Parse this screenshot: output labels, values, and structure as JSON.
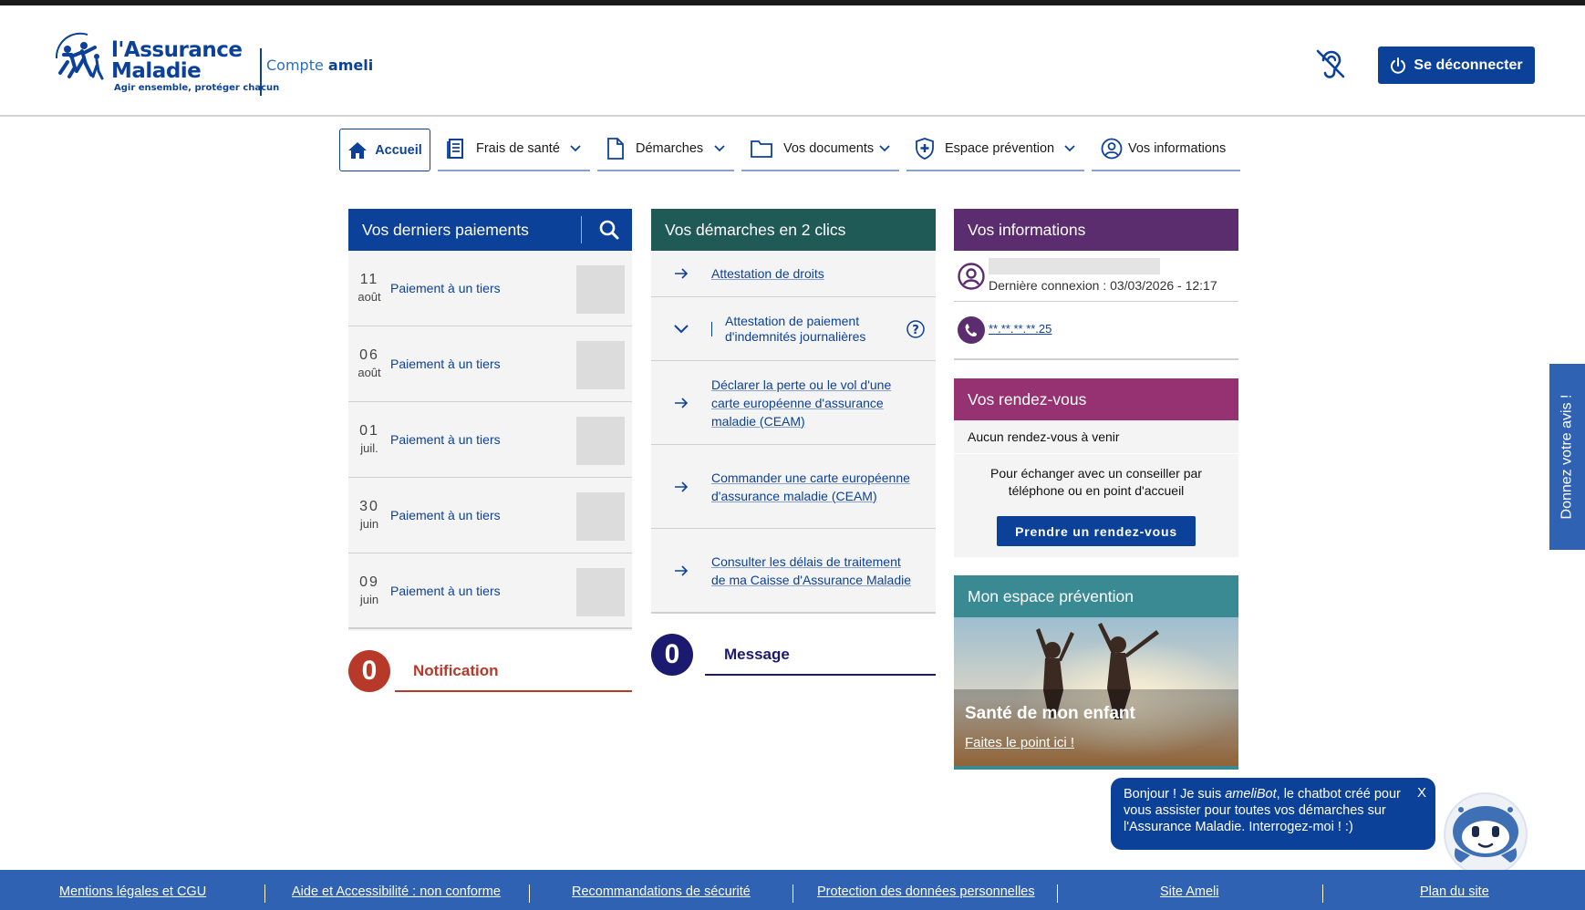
{
  "header": {
    "logo_line1": "l'Assurance",
    "logo_line2": "Maladie",
    "logo_tagline": "Agir ensemble, protéger chacun",
    "brand_compte": "Compte",
    "brand_ameli": "ameli",
    "logout_label": "Se déconnecter"
  },
  "nav": {
    "items": [
      {
        "label": "Accueil"
      },
      {
        "label": "Frais de santé"
      },
      {
        "label": "Démarches"
      },
      {
        "label": "Vos documents"
      },
      {
        "label": "Espace prévention"
      },
      {
        "label": "Vos informations"
      }
    ]
  },
  "payments": {
    "title": "Vos derniers paiements",
    "rows": [
      {
        "day": "11",
        "month": "août",
        "label": "Paiement à un tiers"
      },
      {
        "day": "06",
        "month": "août",
        "label": "Paiement à un tiers"
      },
      {
        "day": "01",
        "month": "juil.",
        "label": "Paiement à un tiers"
      },
      {
        "day": "30",
        "month": "juin",
        "label": "Paiement à un tiers"
      },
      {
        "day": "09",
        "month": "juin",
        "label": "Paiement à un tiers"
      }
    ],
    "notification_count": "0",
    "notification_label": "Notification"
  },
  "demarches": {
    "title": "Vos démarches en 2 clics",
    "rows": [
      {
        "label": "Attestation de droits"
      },
      {
        "label": "Attestation de paiement d'indemnités journalières"
      },
      {
        "label": "Déclarer la perte ou le vol d'une carte européenne d'assurance maladie (CEAM)"
      },
      {
        "label": "Commander une carte européenne d'assurance maladie (CEAM)"
      },
      {
        "label": "Consulter les délais de traitement de ma Caisse d'Assurance Maladie"
      }
    ],
    "message_count": "0",
    "message_label": "Message"
  },
  "infos": {
    "title": "Vos informations",
    "last_login": "Dernière connexion : 03/03/2026 - 12:17",
    "phone": "**.**.**.**.25"
  },
  "rdv": {
    "title": "Vos rendez-vous",
    "none": "Aucun rendez-vous à venir",
    "text": "Pour échanger avec un conseiller par téléphone ou en point d'accueil",
    "button": "Prendre un rendez-vous"
  },
  "prevention": {
    "title": "Mon espace prévention",
    "card_title": "Santé de mon enfant",
    "card_link": "Faites le point ici !"
  },
  "feedback": "Donnez votre avis !",
  "chat": {
    "before": "Bonjour ! Je suis ",
    "bot": "ameliBot",
    "after": ", le chatbot créé pour vous assister pour toutes vos démarches sur l'Assurance Maladie. Interrogez-moi ! :)",
    "close": "X"
  },
  "footer": {
    "links": [
      "Mentions légales et CGU",
      "Aide et Accessibilité : non conforme",
      "Recommandations de sécurité",
      "Protection des données personnelles",
      "Site Ameli",
      "Plan du site"
    ]
  },
  "colors": {
    "primary": "#0c419a",
    "payments_header": "#0c419a",
    "demarches_header": "#1f5a57",
    "infos_header": "#5c2d6e",
    "rdv_header": "#963172",
    "prevention_header": "#3a8a93",
    "notification_badge": "#b6392a",
    "message_badge": "#1b1a6e",
    "footer": "#2f62b3"
  }
}
